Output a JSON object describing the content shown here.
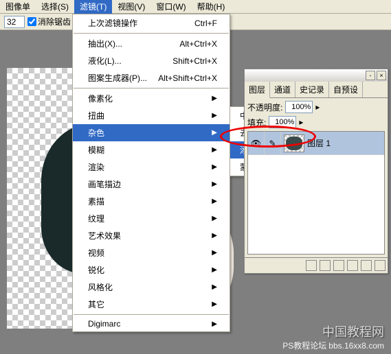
{
  "menubar": {
    "items": [
      "图像单",
      "选择(S)",
      "滤镜(T)",
      "视图(V)",
      "窗口(W)",
      "帮助(H)"
    ]
  },
  "toolbar": {
    "size_value": "32",
    "antialias_label": "消除锯齿"
  },
  "filter_menu": {
    "last_label": "上次滤镜操作",
    "last_shortcut": "Ctrl+F",
    "extract_label": "抽出(X)...",
    "extract_shortcut": "Alt+Ctrl+X",
    "liquify_label": "液化(L)...",
    "liquify_shortcut": "Shift+Ctrl+X",
    "pattern_label": "图案生成器(P)...",
    "pattern_shortcut": "Alt+Shift+Ctrl+X",
    "groups": [
      "像素化",
      "扭曲",
      "杂色",
      "模糊",
      "渲染",
      "画笔描边",
      "素描",
      "纹理",
      "艺术效果",
      "视频",
      "锐化",
      "风格化",
      "其它"
    ],
    "digimarc": "Digimarc"
  },
  "noise_submenu": {
    "items": [
      "中间值...",
      "去斑",
      "添加杂色...",
      "蒙尘与划痕..."
    ]
  },
  "layers_panel": {
    "tabs": [
      "图层",
      "通道",
      "史记录",
      "自预设"
    ],
    "opacity_label": "不透明度:",
    "opacity_value": "100%",
    "fill_label": "填充:",
    "fill_value": "100%",
    "layer_name": "图层 1"
  },
  "watermark": {
    "main": "中国教程网",
    "sub1": "PS教程论坛",
    "sub2": "bbs.16xx8.com"
  }
}
